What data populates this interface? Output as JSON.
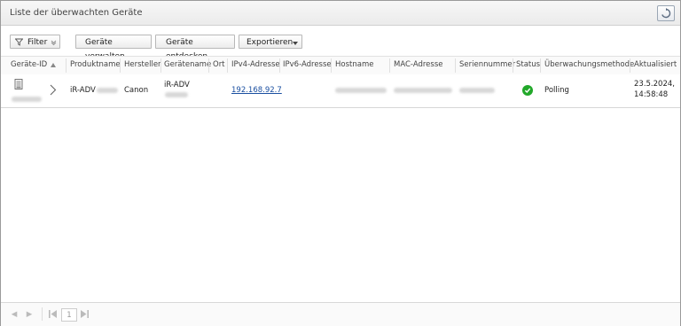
{
  "window": {
    "title": "Liste der überwachten Geräte"
  },
  "toolbar": {
    "filter_label": "Filter",
    "manage_label": "Geräte verwalten",
    "discover_label": "Geräte entdecken",
    "export_label": "Exportieren"
  },
  "table": {
    "columns": [
      "Geräte-ID",
      "Produktname",
      "Hersteller",
      "Gerätename",
      "Ort",
      "IPv4-Adresse",
      "IPv6-Adresse",
      "Hostname",
      "MAC-Adresse",
      "Seriennummer",
      "Status",
      "Überwachungsmethode",
      "Aktualisiert"
    ],
    "sort_column": "Geräte-ID",
    "rows": [
      {
        "product": "iR-ADV",
        "manufacturer": "Canon",
        "device_name": "iR-ADV",
        "ipv4": "192.168.92.7",
        "status": "ok",
        "method": "Polling",
        "updated_date": "23.5.2024,",
        "updated_time": "14:58:48"
      }
    ]
  },
  "pagination": {
    "page": "1"
  },
  "colors": {
    "status_ok": "#22a82a",
    "link": "#1a4fa0"
  },
  "icons": {
    "refresh": "refresh-icon",
    "filter": "filter-icon",
    "expand": "chevron-down-icon",
    "row_expand": "chevron-right-icon",
    "sort": "sort-ascending-icon",
    "device": "printer-document-icon",
    "status": "check-circle-icon"
  }
}
